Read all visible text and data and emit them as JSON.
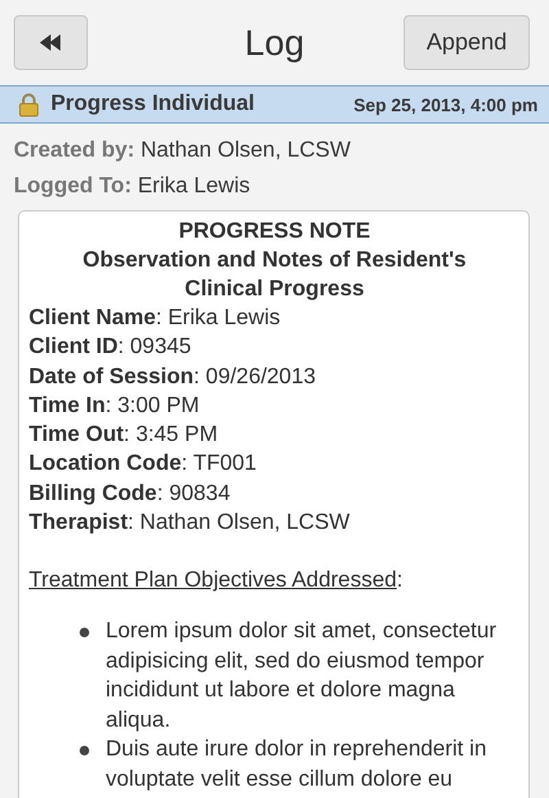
{
  "header": {
    "back_button": {
      "kind": "rewind"
    },
    "title": "Log",
    "append_button": "Append"
  },
  "banner": {
    "locked": true,
    "title": "Progress Individual",
    "date": "Sep 25, 2013, 4:00 pm"
  },
  "meta": [
    {
      "label": "Created by:",
      "value": "Nathan Olsen, LCSW"
    },
    {
      "label": "Logged To:",
      "value": "Erika Lewis"
    }
  ],
  "note": {
    "title_lines": [
      "PROGRESS NOTE",
      "Observation and Notes of Resident's",
      "Clinical Progress"
    ],
    "fields": [
      "**Client Name**: Erika Lewis",
      "**Client ID**: 09345",
      "**Date of Session**: 09/26/2013",
      "**Time In**: 3:00 PM",
      "**Time Out**: 3:45 PM",
      "**Location Code**: TF001",
      "**Billing Code**: 90834",
      "**Therapist**: Nathan Olsen, LCSW"
    ],
    "section": {
      "heading": "Treatment Plan Objectives Addressed",
      "suffix": ":"
    },
    "bullets": [
      "Lorem ipsum dolor sit amet, consectetur adipisicing elit, sed do eiusmod tempor incididunt ut labore et dolore magna aliqua.",
      "Duis aute irure dolor in reprehenderit in voluptate velit esse cillum dolore eu"
    ]
  }
}
